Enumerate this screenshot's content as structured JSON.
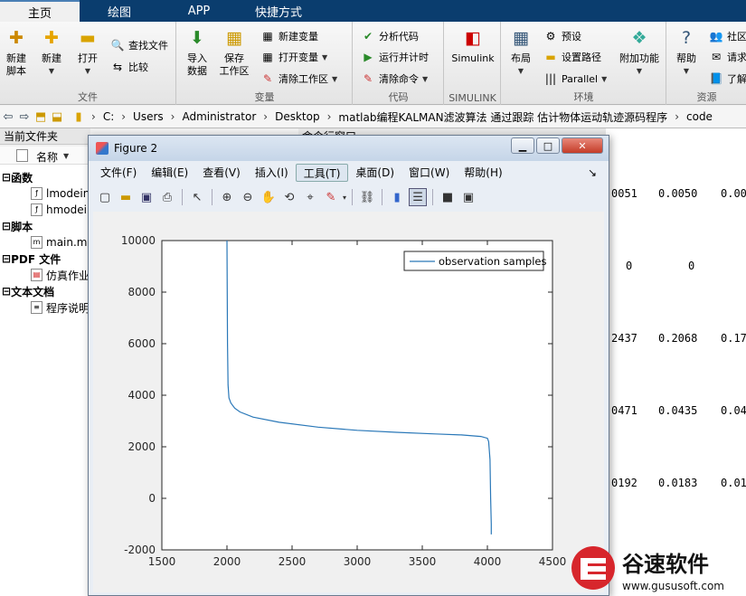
{
  "tabs": [
    {
      "label": "主页",
      "active": true
    },
    {
      "label": "绘图"
    },
    {
      "label": "APP"
    },
    {
      "label": "快捷方式"
    }
  ],
  "ribbon": {
    "file": {
      "group": "文件",
      "new_script": "新建\n脚本",
      "new": "新建",
      "open": "打开",
      "find_files": "查找文件",
      "compare": "比较"
    },
    "variable": {
      "group": "变量",
      "import": "导入\n数据",
      "save_ws": "保存\n工作区",
      "new_var": "新建变量",
      "open_var": "打开变量",
      "clear_ws": "清除工作区"
    },
    "code": {
      "group": "代码",
      "analyze": "分析代码",
      "run_time": "运行并计时",
      "clear_cmd": "清除命令"
    },
    "simulink": {
      "group": "SIMULINK",
      "label": "Simulink"
    },
    "env": {
      "group": "环境",
      "layout": "布局",
      "prefs": "预设",
      "set_path": "设置路径",
      "parallel": "Parallel",
      "addons": "附加功能"
    },
    "resources": {
      "group": "资源",
      "help": "帮助",
      "community": "社区",
      "request": "请求",
      "learn": "了解"
    }
  },
  "address": {
    "crumbs": [
      "C:",
      "Users",
      "Administrator",
      "Desktop",
      "matlab编程KALMAN滤波算法 通过跟踪 估计物体运动轨迹源码程序",
      "code"
    ]
  },
  "file_browser": {
    "title": "当前文件夹",
    "name_header": "名称",
    "cat_functions": "函数",
    "f1": "lmodein",
    "f2": "hmodei",
    "cat_scripts": "脚本",
    "s1": "main.m",
    "cat_pdf": "PDF 文件",
    "p1": "仿真作业",
    "cat_docs": "文本文档",
    "d1": "程序说明"
  },
  "command_window": {
    "title": "命令行窗口",
    "rows": [
      [
        "0051",
        "0.0050",
        "0.00"
      ],
      [
        "0",
        "0",
        ""
      ],
      [
        "2437",
        "0.2068",
        "0.17"
      ],
      [
        "0471",
        "0.0435",
        "0.04"
      ],
      [
        "0192",
        "0.0183",
        "0.01"
      ]
    ]
  },
  "figure": {
    "title": "Figure 2",
    "menu": [
      "文件(F)",
      "编辑(E)",
      "查看(V)",
      "插入(I)",
      "工具(T)",
      "桌面(D)",
      "窗口(W)",
      "帮助(H)"
    ],
    "colors": {
      "line": "#2a78b8"
    }
  },
  "chart_data": {
    "type": "line",
    "title": "",
    "xlabel": "",
    "ylabel": "",
    "xlim": [
      1500,
      4500
    ],
    "ylim": [
      -2000,
      10000
    ],
    "xticks": [
      1500,
      2000,
      2500,
      3000,
      3500,
      4000,
      4500
    ],
    "yticks": [
      -2000,
      0,
      2000,
      4000,
      6000,
      8000,
      10000
    ],
    "grid": false,
    "legend_position": "top-right",
    "series": [
      {
        "name": "observation samples",
        "x": [
          2000,
          2002,
          2004,
          2008,
          2015,
          2030,
          2060,
          2100,
          2200,
          2400,
          2700,
          3000,
          3300,
          3600,
          3800,
          3950,
          4000,
          4010,
          4020,
          4025,
          4030,
          4030
        ],
        "y": [
          10000,
          8000,
          6000,
          4400,
          3900,
          3700,
          3500,
          3350,
          3150,
          2950,
          2760,
          2640,
          2560,
          2500,
          2460,
          2400,
          2330,
          2200,
          1500,
          0,
          -1000,
          -1400
        ]
      }
    ]
  },
  "watermark": {
    "brand": "谷速软件",
    "url": "www.gususoft.com"
  }
}
